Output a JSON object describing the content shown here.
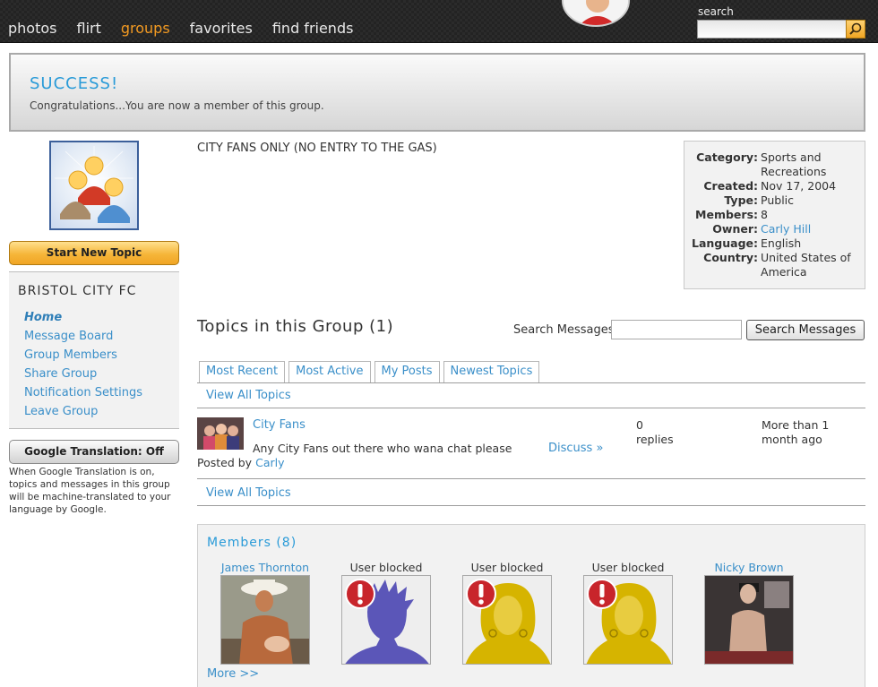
{
  "nav": {
    "items": [
      "photos",
      "flirt",
      "groups",
      "favorites",
      "find friends"
    ],
    "active_index": 2,
    "search_label": "search",
    "search_value": ""
  },
  "banner": {
    "title": "SUCCESS!",
    "message": "Congratulations...You are now a member of this group."
  },
  "sidebar": {
    "start_topic_label": "Start New Topic",
    "group_name": "BRISTOL CITY FC",
    "links": [
      "Home",
      "Message Board",
      "Group Members",
      "Share Group",
      "Notification Settings",
      "Leave Group"
    ],
    "current_link": "Home",
    "translation_button": "Google Translation: Off",
    "translation_note": "When Google Translation is on, topics and messages in this group will be machine-translated to your language by Google."
  },
  "group": {
    "description": "CITY FANS ONLY (NO ENTRY TO THE GAS)",
    "info": [
      {
        "key": "Category:",
        "value": "Sports and Recreations"
      },
      {
        "key": "Created:",
        "value": "Nov 17, 2004"
      },
      {
        "key": "Type:",
        "value": "Public"
      },
      {
        "key": "Members:",
        "value": "8"
      },
      {
        "key": "Owner:",
        "value": "Carly Hill",
        "link": true
      },
      {
        "key": "Language:",
        "value": "English"
      },
      {
        "key": "Country:",
        "value": "United States of America"
      }
    ]
  },
  "topics": {
    "heading": "Topics in this Group (1)",
    "search_label": "Search Messages",
    "search_value": "",
    "search_button": "Search Messages",
    "tabs": [
      "Most Recent",
      "Most Active",
      "My Posts",
      "Newest Topics"
    ],
    "view_all": "View All Topics",
    "items": [
      {
        "title": "City Fans",
        "excerpt": "Any City Fans out there who wana chat please",
        "posted_by_label": "Posted by",
        "author": "Carly",
        "discuss": "Discuss »",
        "replies_count": "0",
        "replies_label": "replies",
        "age": "More than 1 month ago"
      }
    ]
  },
  "members": {
    "heading": "Members (8)",
    "list": [
      {
        "name": "James Thornton",
        "blocked": false
      },
      {
        "name": "User blocked",
        "blocked": true,
        "avatar_color": "#5b56b8"
      },
      {
        "name": "User blocked",
        "blocked": true,
        "avatar_color": "#d6b400"
      },
      {
        "name": "User blocked",
        "blocked": true,
        "avatar_color": "#d6b400"
      },
      {
        "name": "Nicky Brown",
        "blocked": false
      }
    ],
    "more": "More >>"
  },
  "colors": {
    "accent": "#f29a22",
    "link": "#3a8fc9",
    "title_blue": "#2a9bd8",
    "blocked_badge": "#c8252b"
  }
}
